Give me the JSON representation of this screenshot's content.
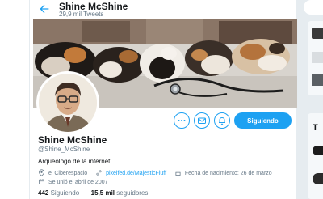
{
  "header": {
    "title": "Shine McShine",
    "tweet_count": "29,9 mil Tweets"
  },
  "profile": {
    "name": "Shine McShine",
    "handle": "@Shine_McShine",
    "bio": "Arqueólogo de la internet",
    "location": "el Ciberespacio",
    "website": "pixelfed.de/MajesticFluff",
    "birthday": "Fecha de nacimiento: 26 de marzo",
    "joined": "Se unió el abril de 2007",
    "following_count": "442",
    "following_label": "Siguiendo",
    "followers_count": "15,5 mil",
    "followers_label": "seguidores"
  },
  "actions": {
    "follow_label": "Siguiendo"
  },
  "right_sidebar": {
    "partial_heading": "T"
  },
  "colors": {
    "accent": "#1da1f2",
    "text": "#14171a",
    "muted": "#657786"
  }
}
